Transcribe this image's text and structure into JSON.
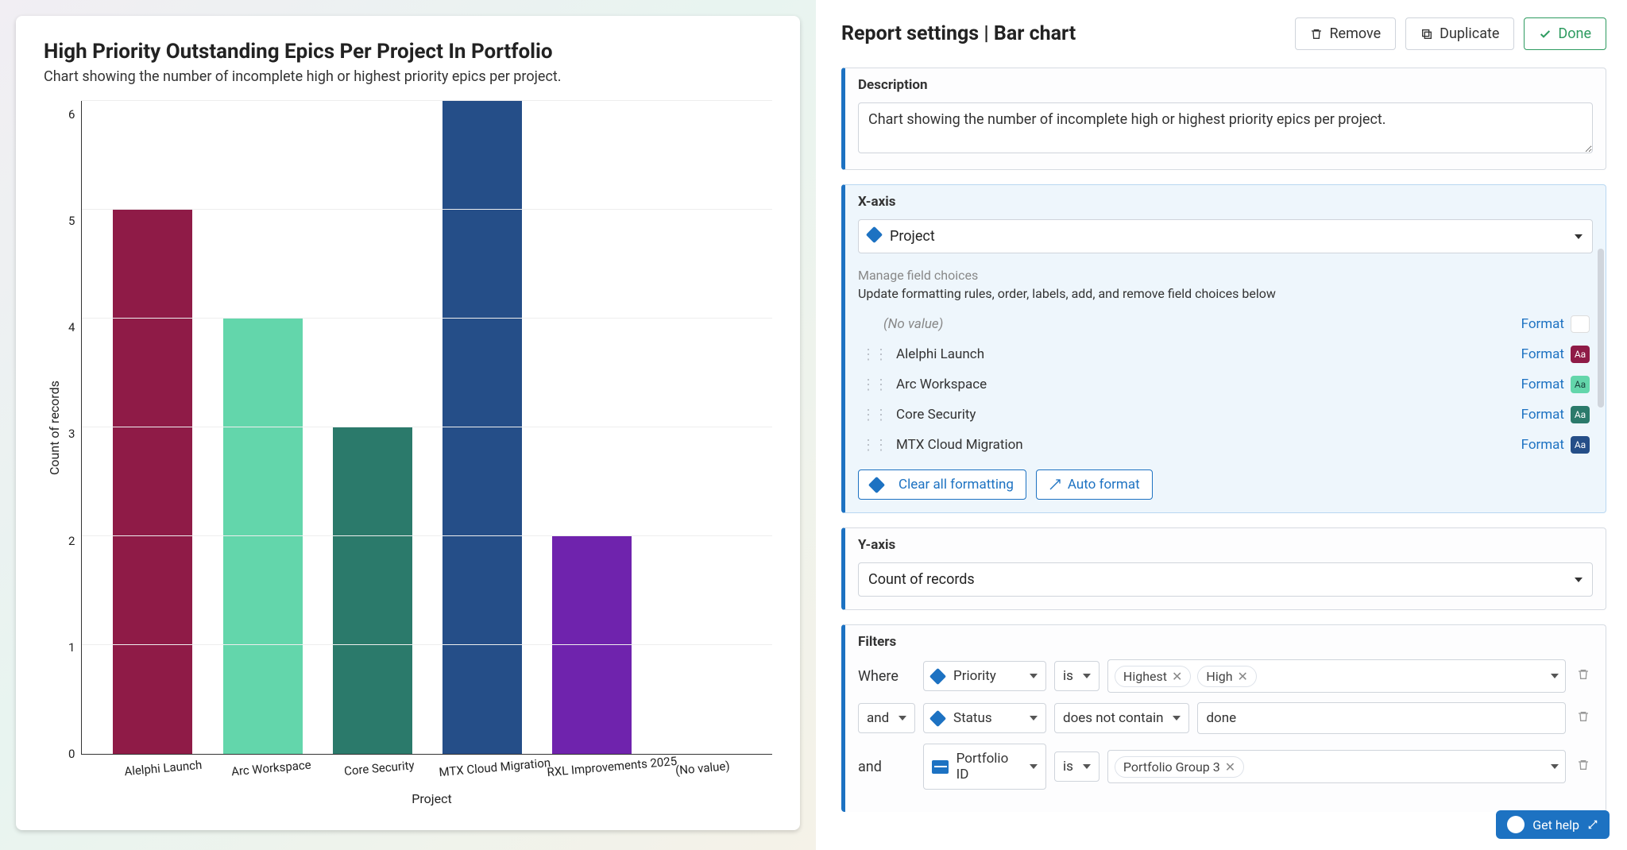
{
  "chart_title": "High Priority Outstanding Epics Per Project In Portfolio",
  "chart_subtitle": "Chart showing the number of incomplete high or highest priority epics per project.",
  "chart_data": {
    "type": "bar",
    "title": "High Priority Outstanding Epics Per Project In Portfolio",
    "xlabel": "Project",
    "ylabel": "Count of records",
    "ylim": [
      0,
      6
    ],
    "yticks": [
      0,
      1,
      2,
      3,
      4,
      5,
      6
    ],
    "categories": [
      "Alelphi Launch",
      "Arc Workspace",
      "Core Security",
      "MTX Cloud Migration",
      "RXL Improvements 2025",
      "(No value)"
    ],
    "values": [
      5,
      4,
      3,
      6,
      2,
      0
    ],
    "colors": [
      "#8f1b47",
      "#63d6ab",
      "#2b7a6b",
      "#254e88",
      "#6f23ad",
      "#cccccc"
    ]
  },
  "settings": {
    "title": "Report settings | Bar chart",
    "remove": "Remove",
    "duplicate": "Duplicate",
    "done": "Done"
  },
  "description": {
    "label": "Description",
    "value": "Chart showing the number of incomplete high or highest priority epics per project."
  },
  "xaxis": {
    "label": "X-axis",
    "field": "Project",
    "manage_title": "Manage field choices",
    "manage_sub": "Update formatting rules, order, labels, add, and remove field choices below",
    "choices": [
      {
        "label": "(No value)",
        "swatch": "#ffffff",
        "text": "light",
        "novalue": true
      },
      {
        "label": "Alelphi Launch",
        "swatch": "#8f1b47",
        "text": "dark"
      },
      {
        "label": "Arc Workspace",
        "swatch": "#63d6ab",
        "text": "light"
      },
      {
        "label": "Core Security",
        "swatch": "#2b7a6b",
        "text": "dark"
      },
      {
        "label": "MTX Cloud Migration",
        "swatch": "#254e88",
        "text": "dark"
      }
    ],
    "format": "Format",
    "clear_all": "Clear all formatting",
    "auto_format": "Auto format"
  },
  "yaxis": {
    "label": "Y-axis",
    "field": "Count of records"
  },
  "filters": {
    "label": "Filters",
    "where": "Where",
    "and": "and",
    "rows": [
      {
        "join": null,
        "field": "Priority",
        "icon": "diamond",
        "op": "is",
        "chips": [
          "Highest",
          "High"
        ]
      },
      {
        "join": "and",
        "field": "Status",
        "icon": "diamond",
        "op": "does not contain",
        "text": "done"
      },
      {
        "join": "and",
        "field": "Portfolio ID",
        "icon": "id",
        "op": "is",
        "chips": [
          "Portfolio Group 3"
        ]
      }
    ]
  },
  "help": "Get help"
}
